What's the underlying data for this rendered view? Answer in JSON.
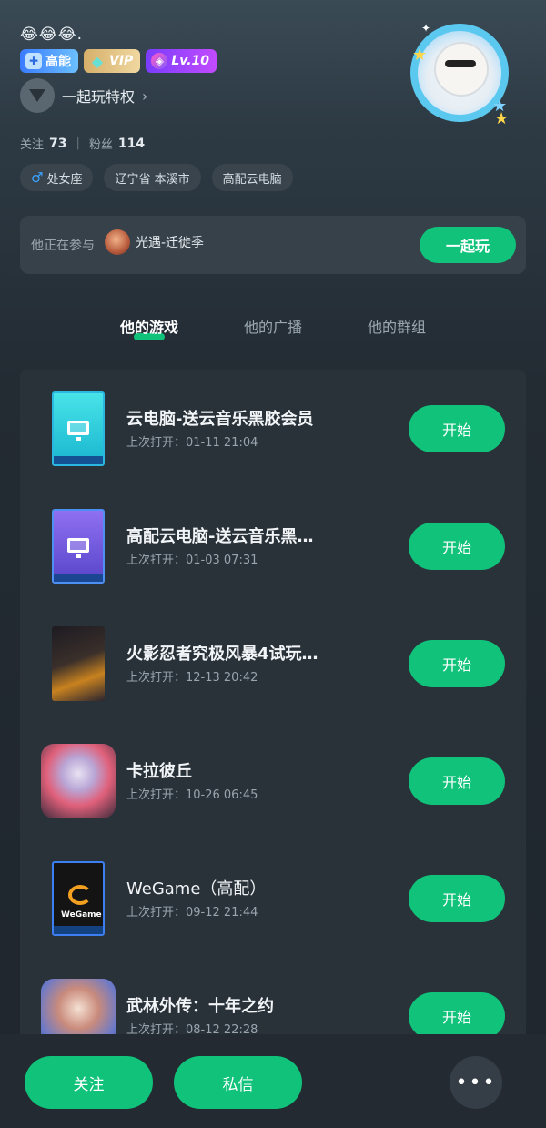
{
  "profile": {
    "emoji_name": "😂😂😂.",
    "badges": [
      {
        "label": "高能",
        "icon": "gamepad-icon"
      },
      {
        "label": "VIP",
        "icon": "diamond-icon"
      },
      {
        "label": "Lv.10",
        "icon": "level-gem-icon"
      }
    ],
    "privilege_label": "一起玩特权",
    "following_label": "关注",
    "following_count": "73",
    "followers_label": "粉丝",
    "followers_count": "114",
    "tags": [
      {
        "label": "处女座",
        "icon": "male-icon"
      },
      {
        "label": "辽宁省 本溪市"
      },
      {
        "label": "高配云电脑"
      }
    ]
  },
  "playing": {
    "label": "他正在参与",
    "game_name": "光遇-迁徙季",
    "button_label": "一起玩"
  },
  "tabs": [
    {
      "label": "他的游戏",
      "active": true
    },
    {
      "label": "他的广播",
      "active": false
    },
    {
      "label": "他的群组",
      "active": false
    }
  ],
  "games": [
    {
      "name": "云电脑-送云音乐黑胶会员",
      "last_opened": "上次打开：01-11 21:04",
      "button": "开始"
    },
    {
      "name": "高配云电脑-送云音乐黑…",
      "last_opened": "上次打开：01-03 07:31",
      "button": "开始"
    },
    {
      "name": "火影忍者究极风暴4试玩…",
      "last_opened": "上次打开：12-13 20:42",
      "button": "开始"
    },
    {
      "name": "卡拉彼丘",
      "last_opened": "上次打开：10-26 06:45",
      "button": "开始"
    },
    {
      "name": "WeGame（高配）",
      "last_opened": "上次打开：09-12 21:44",
      "button": "开始"
    },
    {
      "name": "武林外传：十年之约",
      "last_opened": "上次打开：08-12 22:28",
      "button": "开始"
    }
  ],
  "bottom": {
    "follow_label": "关注",
    "message_label": "私信",
    "more_label": "•••"
  },
  "colors": {
    "accent": "#10c27a",
    "background": "#232b33",
    "panel": "#293139"
  }
}
